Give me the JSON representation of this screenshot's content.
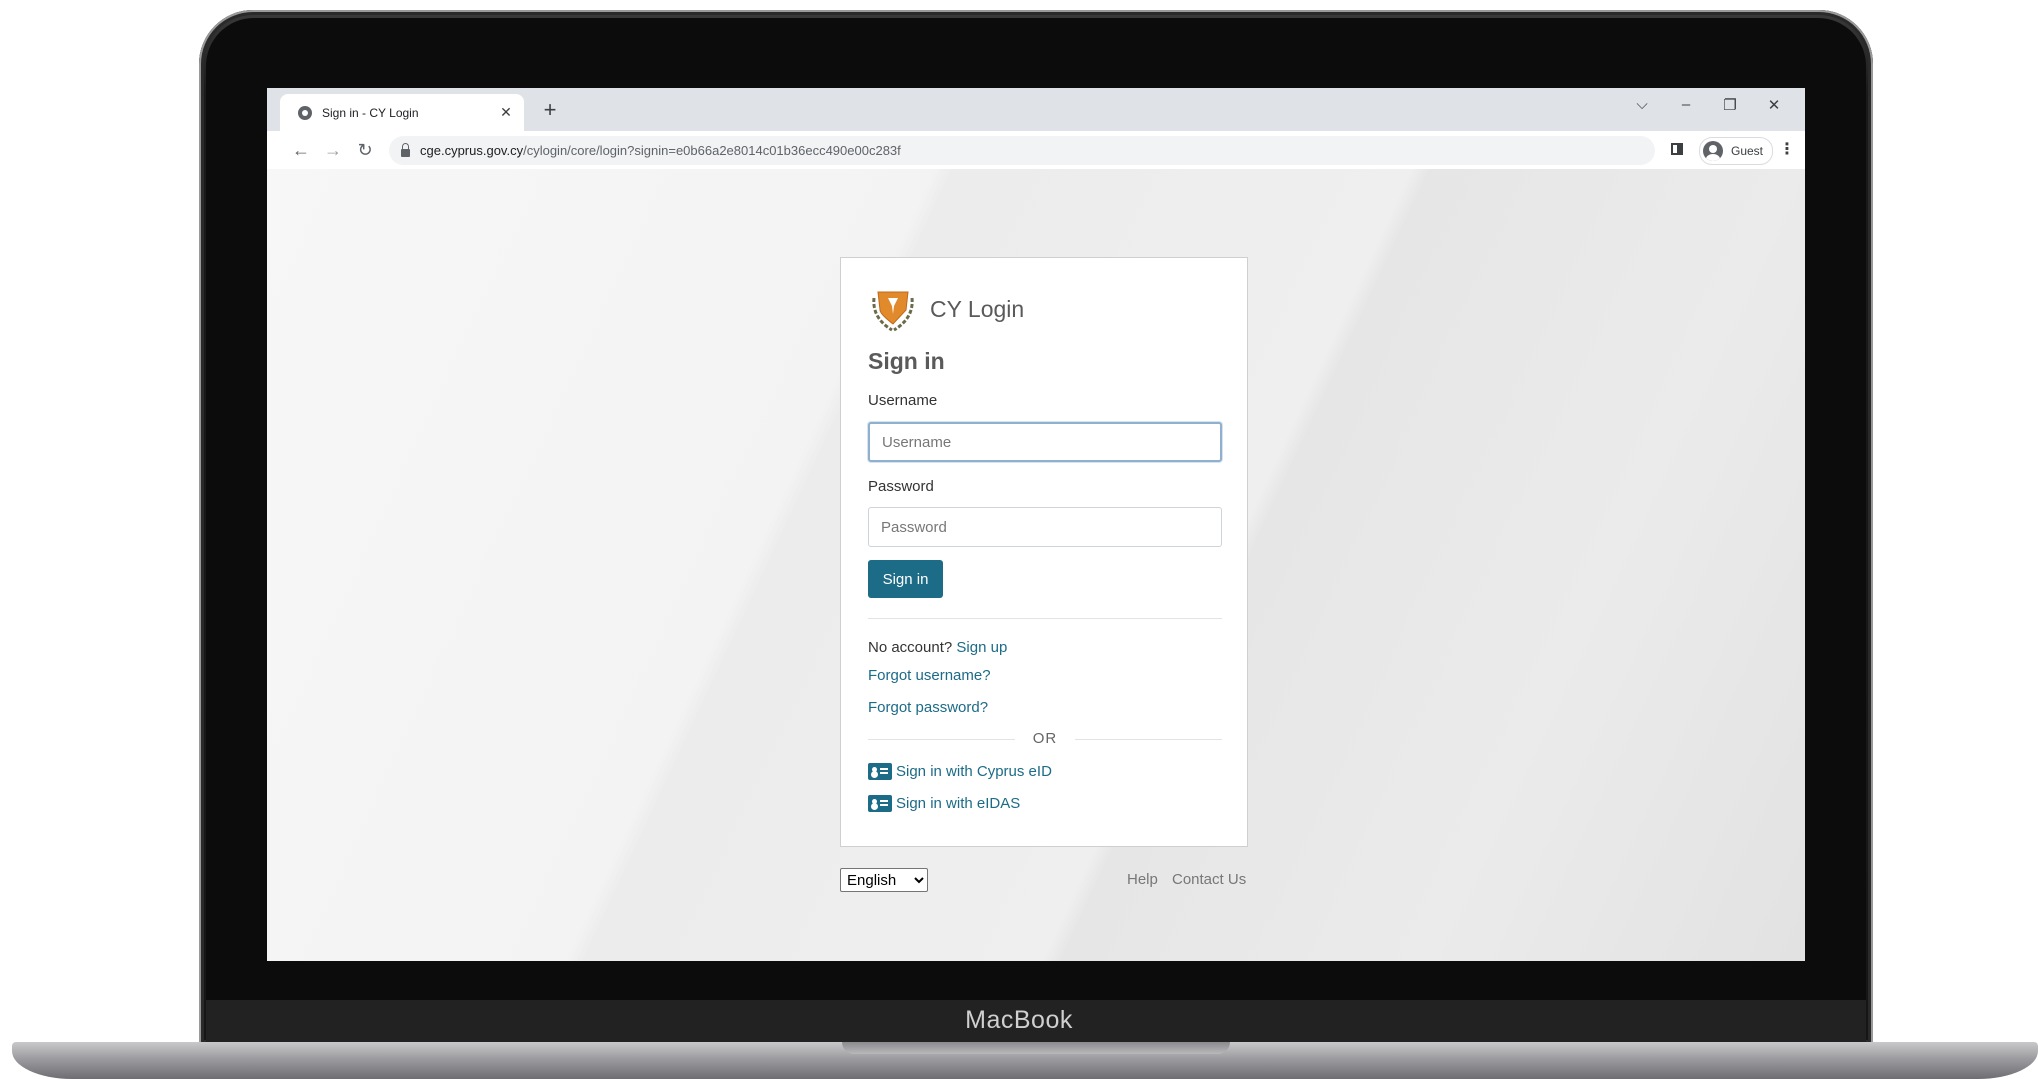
{
  "device": {
    "brand_label": "MacBook"
  },
  "browser": {
    "tab": {
      "title": "Sign in - CY Login",
      "close_glyph": "✕"
    },
    "new_tab_glyph": "+",
    "window_controls": {
      "tab_search": "⌵",
      "minimize": "–",
      "restore": "❐",
      "close": "✕"
    },
    "nav": {
      "back": "←",
      "forward": "→",
      "reload": "↻"
    },
    "url": {
      "host": "cge.cyprus.gov.cy",
      "path": "/cylogin/core/login?signin=e0b66a2e8014c01b36ecc490e00c283f"
    },
    "profile": {
      "label": "Guest"
    },
    "menu_glyph": "⋮"
  },
  "login": {
    "brand_title": "CY Login",
    "heading": "Sign in",
    "username": {
      "label": "Username",
      "placeholder": "Username",
      "value": ""
    },
    "password": {
      "label": "Password",
      "placeholder": "Password",
      "value": ""
    },
    "sign_in_button": "Sign in",
    "no_account_text": "No account?",
    "sign_up_link": "Sign up",
    "forgot_username_link": "Forgot username?",
    "forgot_password_link": "Forgot password?",
    "or_text": "OR",
    "cyprus_eid_link": "Sign in with Cyprus eID",
    "eidas_link": "Sign in with eIDAS"
  },
  "footer": {
    "language": {
      "selected": "English",
      "options": [
        "English"
      ]
    },
    "help_link": "Help",
    "contact_link": "Contact Us"
  },
  "colors": {
    "accent": "#1c6b87",
    "emblem_shield": "#e08a2c",
    "emblem_wreath": "#6b6b4a"
  }
}
